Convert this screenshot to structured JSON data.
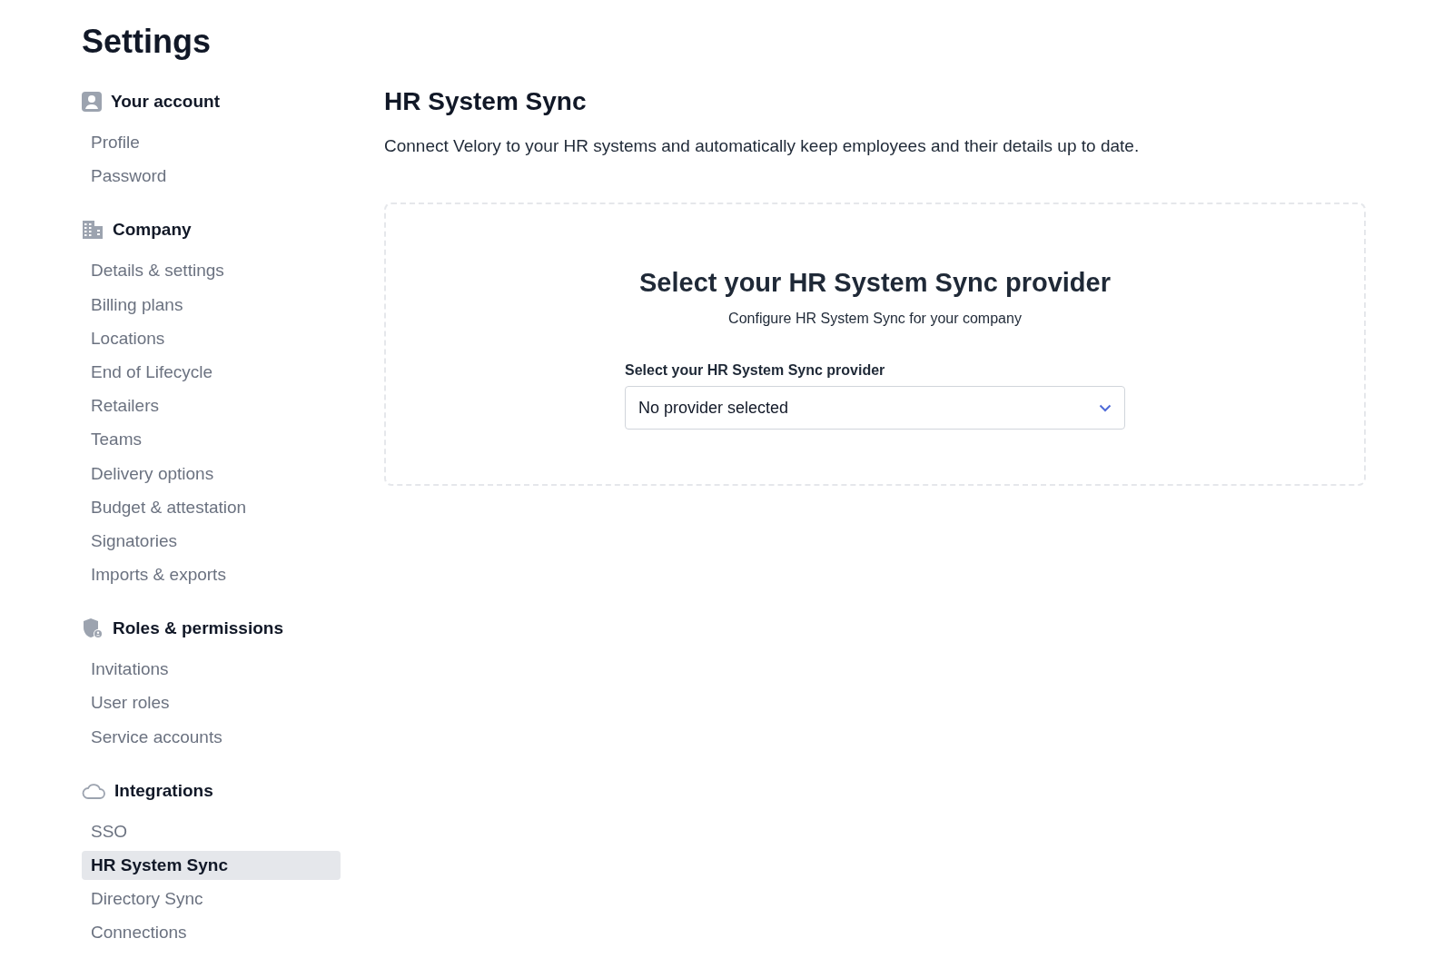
{
  "title": "Settings",
  "sidebar": {
    "groups": [
      {
        "label": "Your account",
        "items": [
          {
            "label": "Profile",
            "selected": false
          },
          {
            "label": "Password",
            "selected": false
          }
        ]
      },
      {
        "label": "Company",
        "items": [
          {
            "label": "Details & settings",
            "selected": false
          },
          {
            "label": "Billing plans",
            "selected": false
          },
          {
            "label": "Locations",
            "selected": false
          },
          {
            "label": "End of Lifecycle",
            "selected": false
          },
          {
            "label": "Retailers",
            "selected": false
          },
          {
            "label": "Teams",
            "selected": false
          },
          {
            "label": "Delivery options",
            "selected": false
          },
          {
            "label": "Budget & attestation",
            "selected": false
          },
          {
            "label": "Signatories",
            "selected": false
          },
          {
            "label": "Imports & exports",
            "selected": false
          }
        ]
      },
      {
        "label": "Roles & permissions",
        "items": [
          {
            "label": "Invitations",
            "selected": false
          },
          {
            "label": "User roles",
            "selected": false
          },
          {
            "label": "Service accounts",
            "selected": false
          }
        ]
      },
      {
        "label": "Integrations",
        "items": [
          {
            "label": "SSO",
            "selected": false
          },
          {
            "label": "HR System Sync",
            "selected": true
          },
          {
            "label": "Directory Sync",
            "selected": false
          },
          {
            "label": "Connections",
            "selected": false
          }
        ]
      }
    ]
  },
  "main": {
    "heading": "HR System Sync",
    "description": "Connect Velory to your HR systems and automatically keep employees and their details up to date.",
    "card": {
      "title": "Select your HR System Sync provider",
      "subtitle": "Configure HR System Sync for your company",
      "field_label": "Select your HR System Sync provider",
      "select_value": "No provider selected"
    }
  }
}
